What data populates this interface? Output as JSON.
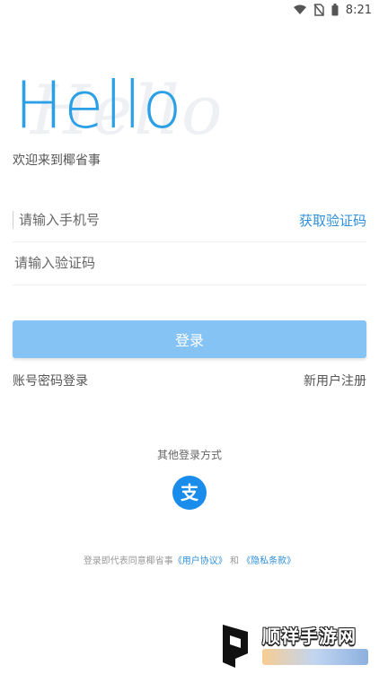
{
  "status_bar": {
    "time": "8:21",
    "icons": [
      "wifi-icon",
      "no-sim-icon",
      "battery-icon"
    ]
  },
  "header": {
    "hello": "Hello",
    "hello_ghost": "Hello",
    "welcome": "欢迎来到椰省事"
  },
  "phone": {
    "placeholder": "请输入手机号",
    "get_code": "获取验证码"
  },
  "code": {
    "placeholder": "请输入验证码"
  },
  "login_button": "登录",
  "links": {
    "password_login": "账号密码登录",
    "register": "新用户注册"
  },
  "other_login": {
    "title": "其他登录方式",
    "methods": [
      "alipay-icon"
    ]
  },
  "agreement": {
    "prefix": "登录即代表同意椰省事",
    "user_agreement": "《用户协议》",
    "and": "和",
    "privacy_policy": "《隐私条款》"
  },
  "watermark": {
    "title": "顺祥手游网"
  },
  "colors": {
    "accent": "#2ca0e6",
    "button": "#85c3f4",
    "link": "#2f8fd8",
    "alipay": "#1a8ceb"
  }
}
